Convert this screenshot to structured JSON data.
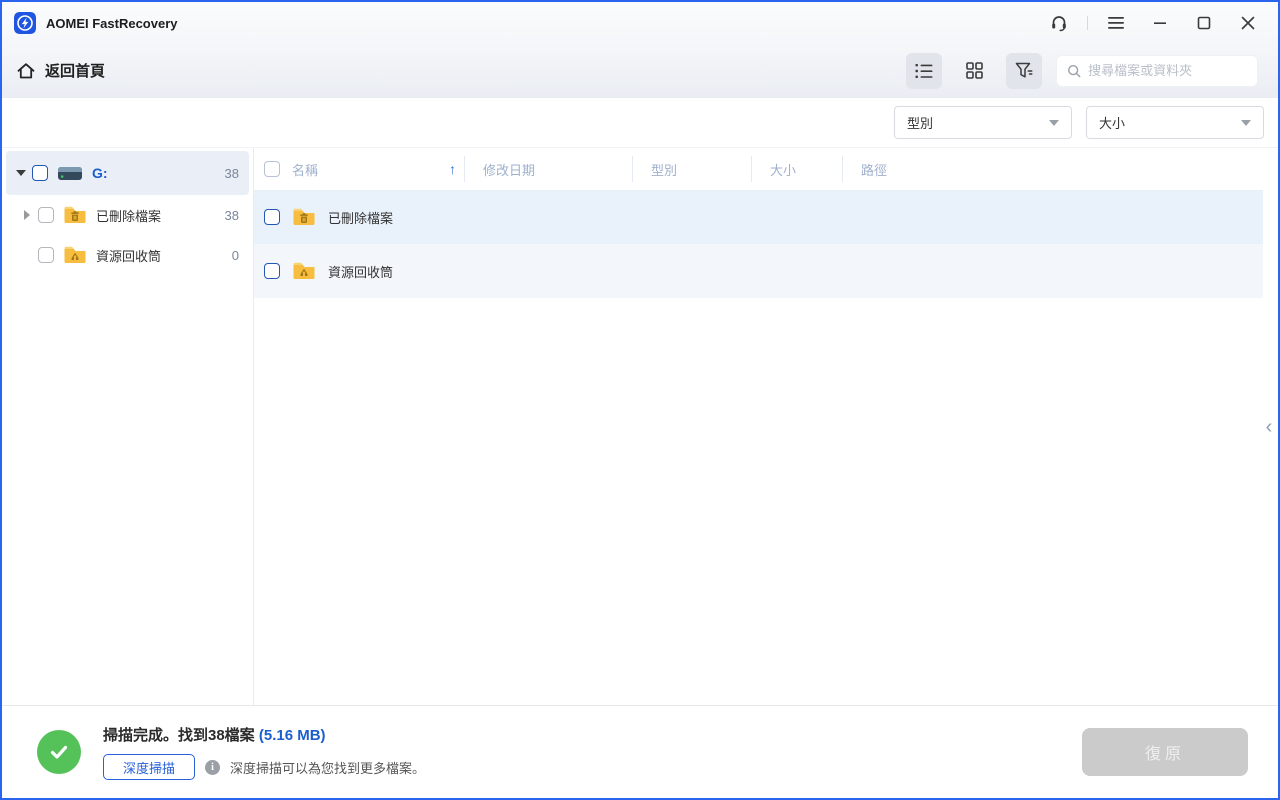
{
  "window": {
    "title": "AOMEI FastRecovery"
  },
  "nav": {
    "back_home": "返回首頁",
    "search_placeholder": "搜尋檔案或資料夾"
  },
  "filters": {
    "type_select": "型別",
    "size_select": "大小"
  },
  "sidebar": {
    "drive": {
      "label": "G:",
      "count": "38"
    },
    "items": [
      {
        "label": "已刪除檔案",
        "count": "38",
        "icon": "folder-trash-icon"
      },
      {
        "label": "資源回收筒",
        "count": "0",
        "icon": "folder-recycle-icon"
      }
    ]
  },
  "table": {
    "columns": {
      "name": "名稱",
      "date": "修改日期",
      "type": "型別",
      "size": "大小",
      "path": "路徑"
    },
    "sort_icon": "↑",
    "rows": [
      {
        "name": "已刪除檔案",
        "icon": "folder-trash-icon"
      },
      {
        "name": "資源回收筒",
        "icon": "folder-recycle-icon"
      }
    ]
  },
  "collapse_icon": "‹",
  "footer": {
    "status_main": "掃描完成。找到38檔案 ",
    "status_size": "(5.16 MB)",
    "deep_scan_button": "深度掃描",
    "info_glyph": "i",
    "deep_scan_hint": "深度掃描可以為您找到更多檔案。",
    "restore_button": "復原"
  },
  "colors": {
    "accent_blue": "#2760d8",
    "window_border": "#2b64ee",
    "link_blue": "#1a5dcc",
    "success_green": "#55c259",
    "row_shade_a": "#e9f1fb",
    "row_shade_b": "#f3f6fb",
    "selected_tree_row": "#e9eef7",
    "header_text": "#9fb0cc",
    "disabled_button": "#cbcbcb",
    "folder_yellow": "#f6bd41"
  }
}
